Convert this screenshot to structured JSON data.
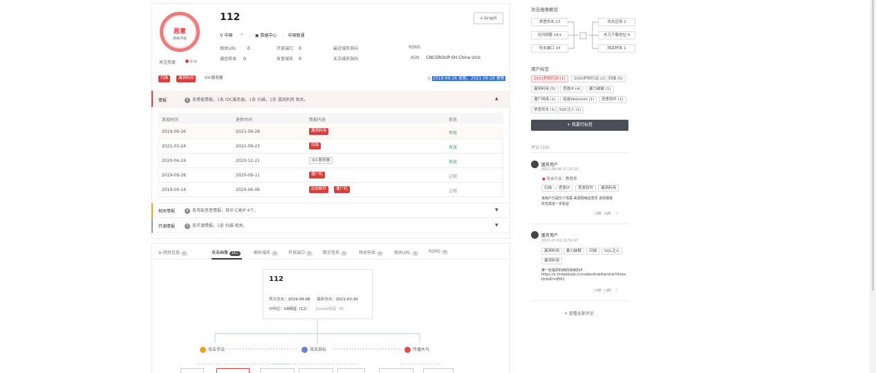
{
  "header": {
    "score_label": "恶意",
    "score_sub": "高级评级",
    "ip": "112",
    "graph_btn": "Graph",
    "location_country": "中国",
    "location_extra": "\"",
    "location_dc": "数据中心",
    "location_isp": "中国联通",
    "fields": {
      "related_url_label": "相关URL",
      "related_url_val": "0",
      "open_port_label": "开放端口",
      "open_port_val": "0",
      "first_domain_label": "最近域名指向",
      "rdns_label": "RDNS",
      "sample_label": "通信样本",
      "sample_val": "0",
      "reverse_label": "反查域名",
      "reverse_val": "0",
      "last_domain_label": "未次域名指向",
      "asn_label": "ASN",
      "asn_val": "CNCGROUP-SH China Unic"
    },
    "hot_label": "关注热度",
    "tags": [
      "扫描",
      "漏洞利用",
      "IDC服务器"
    ],
    "time_info": "2019-09-26 发现，2021-09-28 更新"
  },
  "intel": {
    "title": "情报",
    "count": "5",
    "summary": "条情报情报，1条 IDC服务器，1条 扫描，1条 漏洞利用 相关。",
    "columns": [
      "发现时间",
      "更新时间",
      "情报内容",
      "状态"
    ],
    "rows": [
      {
        "found": "2019-09-26",
        "updated": "2021-09-28",
        "tags": [
          "漏洞利用"
        ],
        "tag_style": "red",
        "status": "有效",
        "status_class": "green"
      },
      {
        "found": "2021-03-24",
        "updated": "2021-09-23",
        "tags": [
          "扫描"
        ],
        "tag_style": "red",
        "status": "有效",
        "status_class": "green"
      },
      {
        "found": "2020-04-24",
        "updated": "2020-12-21",
        "tags": [
          "IDC服务器"
        ],
        "tag_style": "out",
        "status": "有效",
        "status_class": "green"
      },
      {
        "found": "2019-09-28",
        "updated": "2020-09-11",
        "tags": [
          "僵尸机"
        ],
        "tag_style": "red",
        "status": "过期",
        "status_class": "gray"
      },
      {
        "found": "2019-09-14",
        "updated": "2020-06-06",
        "tags": [
          "垃圾邮件",
          "僵尸机"
        ],
        "tag_style": "red",
        "status": "过期",
        "status_class": "gray"
      }
    ]
  },
  "related": {
    "title": "相关情报",
    "count": "4",
    "text": "条可能恶意情报，其中 C类IP 4个。"
  },
  "opensrc": {
    "title": "开源情报",
    "count": "2",
    "text": "条开源情报，1条 扫描 相关。"
  },
  "tabs": [
    {
      "label": "网页信息",
      "count": "0"
    },
    {
      "label": "攻击画像",
      "count": "1K+",
      "active": true
    },
    {
      "label": "解析域名",
      "count": "0"
    },
    {
      "label": "开放端口",
      "count": "0"
    },
    {
      "label": "数字签名",
      "count": "0"
    },
    {
      "label": "相关样本",
      "count": "0"
    },
    {
      "label": "相关URL",
      "count": "0"
    },
    {
      "label": "RDNS",
      "count": "0"
    }
  ],
  "profile": {
    "ip": "112",
    "first_label": "首次攻击：",
    "first_val": "2019-09-08",
    "last_label": "最新攻击：",
    "last_val": "2021-03-30",
    "ua_label": "IP特征：",
    "ua_val": "UA特征（12）",
    "cookie": "Cookie特征（8）",
    "nodes": [
      "攻击手法",
      "攻击目标",
      "传播木马"
    ]
  },
  "right": {
    "overview_title": "攻击画像概览",
    "overview_left": [
      "渗透攻击 22",
      "访问频繁 1K+",
      "攻击端口 14"
    ],
    "overview_right": [
      "攻击应用 2",
      "木马下载地址 4",
      "相关样本 1"
    ],
    "user_tags_title": "用户标签",
    "user_tags": [
      [
        "2021护网行动 (1)",
        "2020护网行动 (2)",
        "扫描 (5)"
      ],
      [
        "漏洞利用 (5)",
        "恶意IP (4)",
        "暴力破解 (1)"
      ],
      [
        "僵尸网络 (1)",
        "连接Webshell (1)",
        "恶意软件 (1)"
      ],
      [
        "渗透攻击 (1)",
        "SQL注入 (1)"
      ]
    ],
    "add_tag_btn": "+ 我要打标签",
    "comments_title": "评论 (19)",
    "comments": [
      {
        "user": "匿名用户",
        "time": "2021-06-06 17:10:23",
        "industry": "攻击行业：教育类",
        "tags": [
          "扫描",
          "恶意IP",
          "恶意软件",
          "漏洞利用"
        ],
        "text1": "该用户已提交了情报 来源网络巡查员 该情报真",
        "text2": "实性需进一步验证",
        "likes": "0",
        "dislikes": "0"
      },
      {
        "user": "匿名用户",
        "time": "2021-07-01 11:51:47",
        "tags": [
          "漏洞利用",
          "暴力破解",
          "扫描",
          "SQL注入",
          "漏洞利用"
        ],
        "text1": "某一些漏洞利用的持续的IP",
        "text2": "https://x.threatbook.cn/nodev4/vb4/article?threa",
        "text3": "tInfoID=8561",
        "likes": "0",
        "dislikes": "0"
      }
    ],
    "view_all": "+ 查看全部评论"
  },
  "colors": {
    "accent": "#e03b3b",
    "warn": "#f0a020",
    "green": "#3aa65a",
    "dark_btn": "#4a4f57"
  }
}
